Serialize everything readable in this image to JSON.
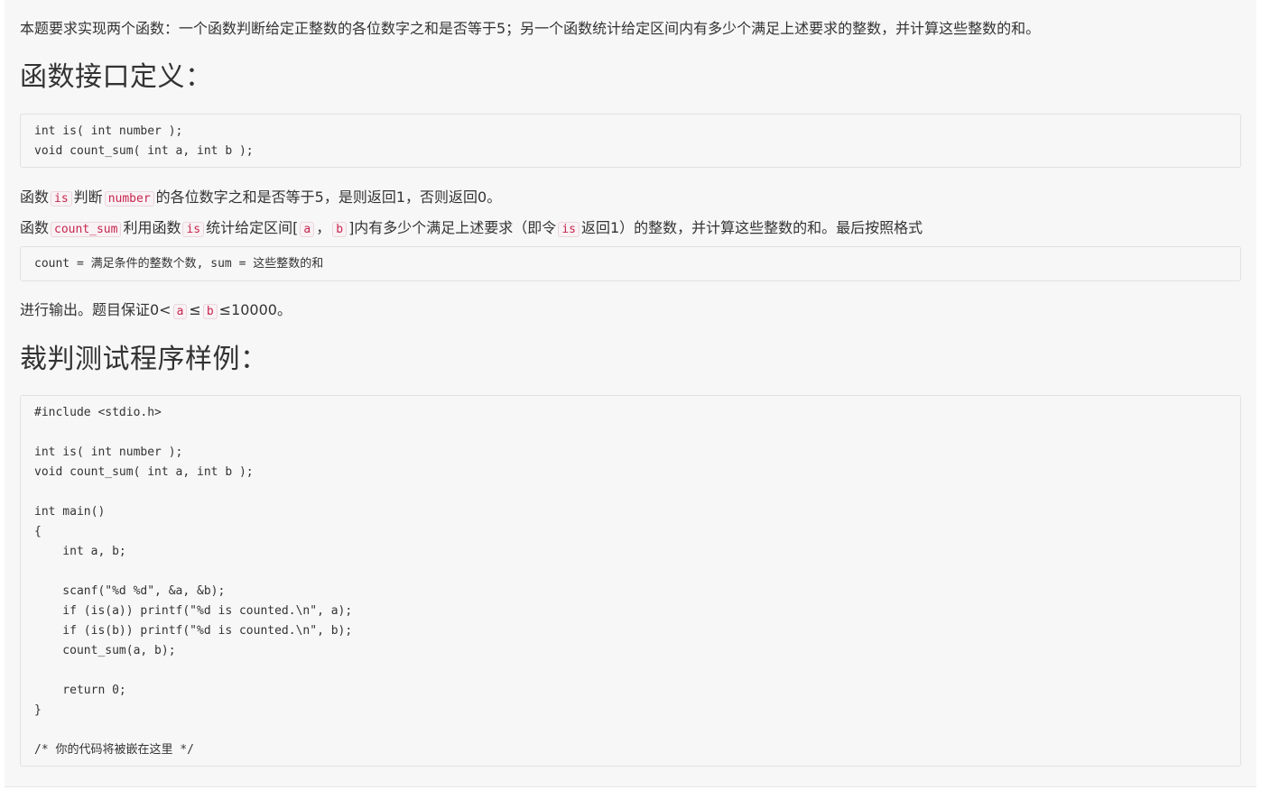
{
  "intro": "本题要求实现两个函数：一个函数判断给定正整数的各位数字之和是否等于5；另一个函数统计给定区间内有多少个满足上述要求的整数，并计算这些整数的和。",
  "heading_interface": "函数接口定义：",
  "interface_code": [
    "int is( int number );",
    "void count_sum( int a, int b );"
  ],
  "desc1": {
    "t1": "函数",
    "c1": "is",
    "t2": "判断",
    "c2": "number",
    "t3": "的各位数字之和是否等于5，是则返回1，否则返回0。"
  },
  "desc2": {
    "t1": "函数",
    "c1": "count_sum",
    "t2": "利用函数",
    "c2": "is",
    "t3": "统计给定区间[",
    "c3": "a",
    "t4": "，",
    "c4": "b",
    "t5": "]内有多少个满足上述要求（即令",
    "c5": "is",
    "t6": "返回1）的整数，并计算这些整数的和。最后按照格式"
  },
  "format_code": [
    "count = 满足条件的整数个数, sum = 这些整数的和"
  ],
  "desc3": {
    "t1": "进行输出。题目保证0<",
    "c1": "a",
    "t2": "≤",
    "c2": "b",
    "t3": "≤10000。"
  },
  "heading_sample": "裁判测试程序样例：",
  "sample_code": [
    "#include <stdio.h>",
    "",
    "int is( int number );",
    "void count_sum( int a, int b );",
    "",
    "int main()",
    "{",
    "    int a, b;",
    "",
    "    scanf(\"%d %d\", &a, &b);",
    "    if (is(a)) printf(\"%d is counted.\\n\", a);",
    "    if (is(b)) printf(\"%d is counted.\\n\", b);",
    "    count_sum(a, b);",
    "",
    "    return 0;",
    "}",
    "",
    "/* 你的代码将被嵌在这里 */"
  ]
}
